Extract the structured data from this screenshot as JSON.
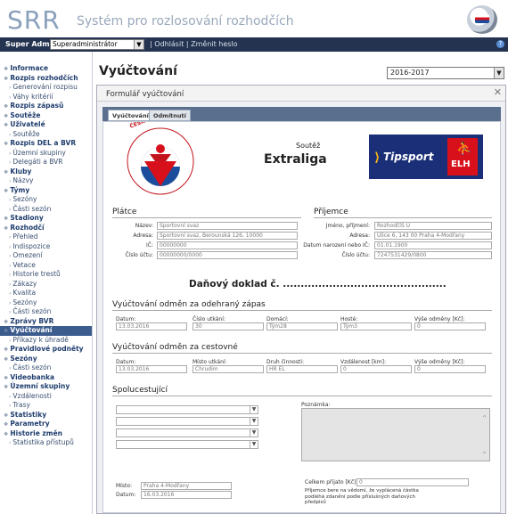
{
  "header": {
    "logo_text": "SRR",
    "app_title": "Systém pro rozlosování rozhodčích"
  },
  "topbar": {
    "role_label": "Super Admin",
    "role_value": "Superadministrátor",
    "links": "| Odhlásit | Změnit heslo"
  },
  "sidebar": {
    "items": [
      {
        "label": "Informace",
        "level": "top"
      },
      {
        "label": "Rozpis rozhodčích",
        "level": "top"
      },
      {
        "label": "Generování rozpisu",
        "level": "sub"
      },
      {
        "label": "Váhy kritérií",
        "level": "sub"
      },
      {
        "label": "Rozpis zápasů",
        "level": "top"
      },
      {
        "label": "Soutěže",
        "level": "top"
      },
      {
        "label": "Uživatelé",
        "level": "top"
      },
      {
        "label": "Soutěže",
        "level": "sub"
      },
      {
        "label": "Rozpis DEL a BVR",
        "level": "top"
      },
      {
        "label": "Územní skupiny",
        "level": "sub"
      },
      {
        "label": "Delegáti a BVR",
        "level": "sub"
      },
      {
        "label": "Kluby",
        "level": "top"
      },
      {
        "label": "Názvy",
        "level": "sub"
      },
      {
        "label": "Týmy",
        "level": "top"
      },
      {
        "label": "Sezóny",
        "level": "sub"
      },
      {
        "label": "Části sezón",
        "level": "sub"
      },
      {
        "label": "Stadiony",
        "level": "top"
      },
      {
        "label": "Rozhodčí",
        "level": "top"
      },
      {
        "label": "Přehled",
        "level": "sub"
      },
      {
        "label": "Indispozice",
        "level": "sub"
      },
      {
        "label": "Omezení",
        "level": "sub"
      },
      {
        "label": "Vetace",
        "level": "sub"
      },
      {
        "label": "Historie trestů",
        "level": "sub"
      },
      {
        "label": "Zákazy",
        "level": "sub"
      },
      {
        "label": "Kvalita",
        "level": "sub"
      },
      {
        "label": "Sezóny",
        "level": "sub"
      },
      {
        "label": "Části sezón",
        "level": "sub"
      },
      {
        "label": "Zprávy BVR",
        "level": "top"
      },
      {
        "label": "Vyúčtování",
        "level": "top",
        "active": true
      },
      {
        "label": "Příkazy k úhradě",
        "level": "sub"
      },
      {
        "label": "Pravidlové podněty",
        "level": "top"
      },
      {
        "label": "Sezóny",
        "level": "top"
      },
      {
        "label": "Části sezón",
        "level": "sub"
      },
      {
        "label": "Videobanka",
        "level": "top"
      },
      {
        "label": "Územní skupiny",
        "level": "top"
      },
      {
        "label": "Vzdálenosti",
        "level": "sub"
      },
      {
        "label": "Trasy",
        "level": "sub"
      },
      {
        "label": "Statistiky",
        "level": "top"
      },
      {
        "label": "Parametry",
        "level": "top"
      },
      {
        "label": "Historie změn",
        "level": "top"
      },
      {
        "label": "Statistika přístupů",
        "level": "sub"
      }
    ]
  },
  "main": {
    "page_title": "Vyúčtování",
    "season": "2016-2017",
    "form_title": "Formulář vyúčtování",
    "tabs": [
      "Vyúčtování",
      "Odmítnutí"
    ]
  },
  "doc": {
    "logo_text": "ČESKÝ SVAZ LEDNÍHO HOKEJE",
    "competition_label": "Soutěž",
    "competition_name": "Extraliga",
    "sponsor_name": "Tipsport",
    "sponsor_badge": "ELH",
    "payer": {
      "title": "Plátce",
      "name_label": "Název:",
      "name": "Sportovní svaz",
      "address_label": "Adresa:",
      "address": "Sportovní svaz, Berounská 126, 10000",
      "ic_label": "IČ:",
      "ic": "00000000",
      "account_label": "Číslo účtu:",
      "account": "00000000/0000"
    },
    "recipient": {
      "title": "Příjemce",
      "name_label": "Jméno, příjmení:",
      "name": "RozhodčíS U",
      "address_label": "Adresa:",
      "address": "Ulice 6, 143 00 Praha 4-Modřany",
      "dob_label": "Datum narození nebo IČ:",
      "dob": "01.01.1900",
      "account_label": "Číslo účtu:",
      "account": "7247531429/0800"
    },
    "tax_doc": "Daňový doklad č. ..............................................",
    "match_section": {
      "title": "Vyúčtování odměn za odehraný zápas",
      "headers": [
        "Datum:",
        "Číslo utkání:",
        "Domácí:",
        "Hosté:",
        "Výše odměny [Kč]:"
      ],
      "values": [
        "13.03.2016",
        "30",
        "Tým28",
        "Tým3",
        "0"
      ]
    },
    "travel_section": {
      "title": "Vyúčtování odměn za cestovné",
      "headers": [
        "Datum:",
        "Místo utkání:",
        "Druh činnosti:",
        "Vzdálenost [km]:",
        "Výše odměny [Kč]:"
      ],
      "values": [
        "13.03.2016",
        "Chrudim",
        "HR EL",
        "0",
        "0"
      ]
    },
    "coworkers": {
      "title": "Spolucestující",
      "note_label": "Poznámka:"
    },
    "footer": {
      "place_label": "Místo:",
      "place": "Praha 4-Modřany",
      "date_label": "Datum:",
      "date": "16.03.2016",
      "total_label": "Celkem přijato [Kč]:",
      "total": "0",
      "declaration": "Příjemce bere na vědomí, že vyplácená částka podléhá zdanění podle příslušných daňových předpisů"
    }
  }
}
